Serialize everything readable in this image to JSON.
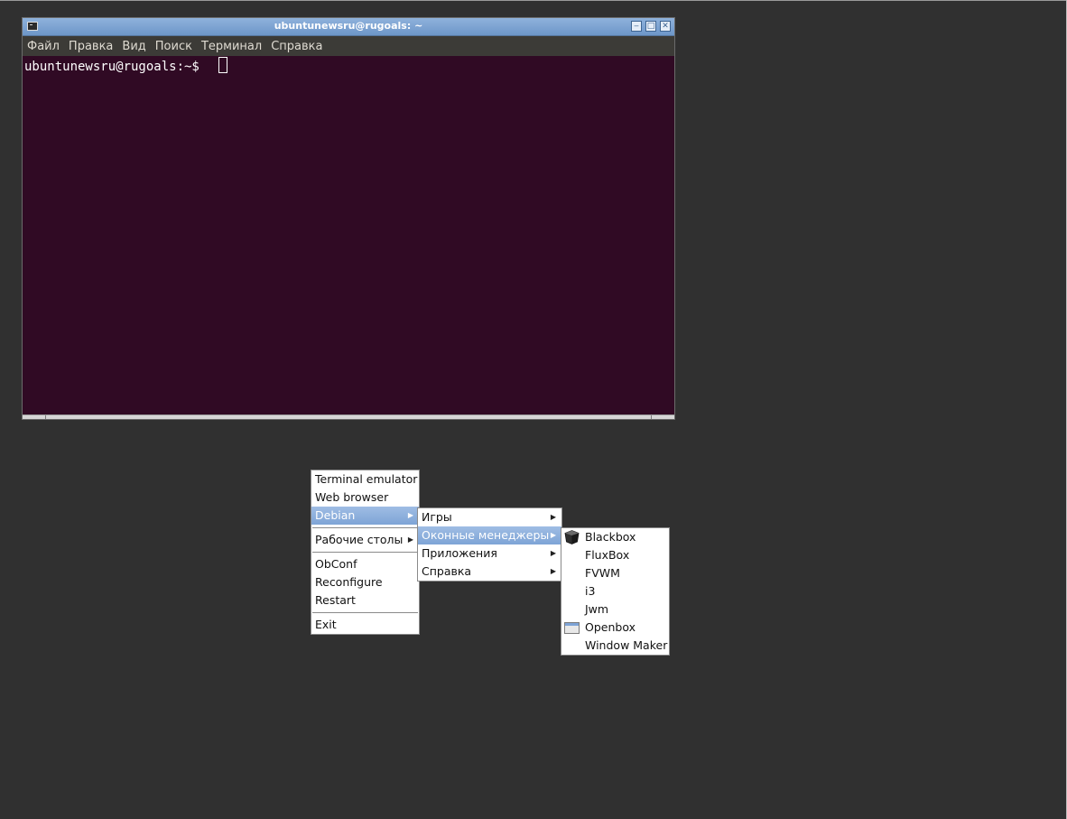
{
  "terminal": {
    "title": "ubuntunewsru@rugoals: ~",
    "menubar": [
      "Файл",
      "Правка",
      "Вид",
      "Поиск",
      "Терминал",
      "Справка"
    ],
    "prompt": "ubuntunewsru@rugoals:~$ "
  },
  "root_menu": {
    "items": [
      {
        "label": "Terminal emulator"
      },
      {
        "label": "Web browser"
      },
      {
        "label": "Debian"
      },
      {
        "label": "Рабочие столы"
      },
      {
        "label": "ObConf"
      },
      {
        "label": "Reconfigure"
      },
      {
        "label": "Restart"
      },
      {
        "label": "Exit"
      }
    ]
  },
  "debian_menu": {
    "items": [
      {
        "label": "Игры"
      },
      {
        "label": "Оконные менеджеры"
      },
      {
        "label": "Приложения"
      },
      {
        "label": "Справка"
      }
    ]
  },
  "wm_menu": {
    "items": [
      {
        "label": "Blackbox",
        "icon": "blackbox-icon"
      },
      {
        "label": "FluxBox"
      },
      {
        "label": "FVWM"
      },
      {
        "label": "i3"
      },
      {
        "label": "Jwm"
      },
      {
        "label": "Openbox",
        "icon": "openbox-icon"
      },
      {
        "label": "Window Maker"
      }
    ]
  },
  "colors": {
    "desktop": "#303030",
    "terminal_bg": "#300a24",
    "menubar_bg": "#3c3b37",
    "selection": "#7ea4d6"
  }
}
